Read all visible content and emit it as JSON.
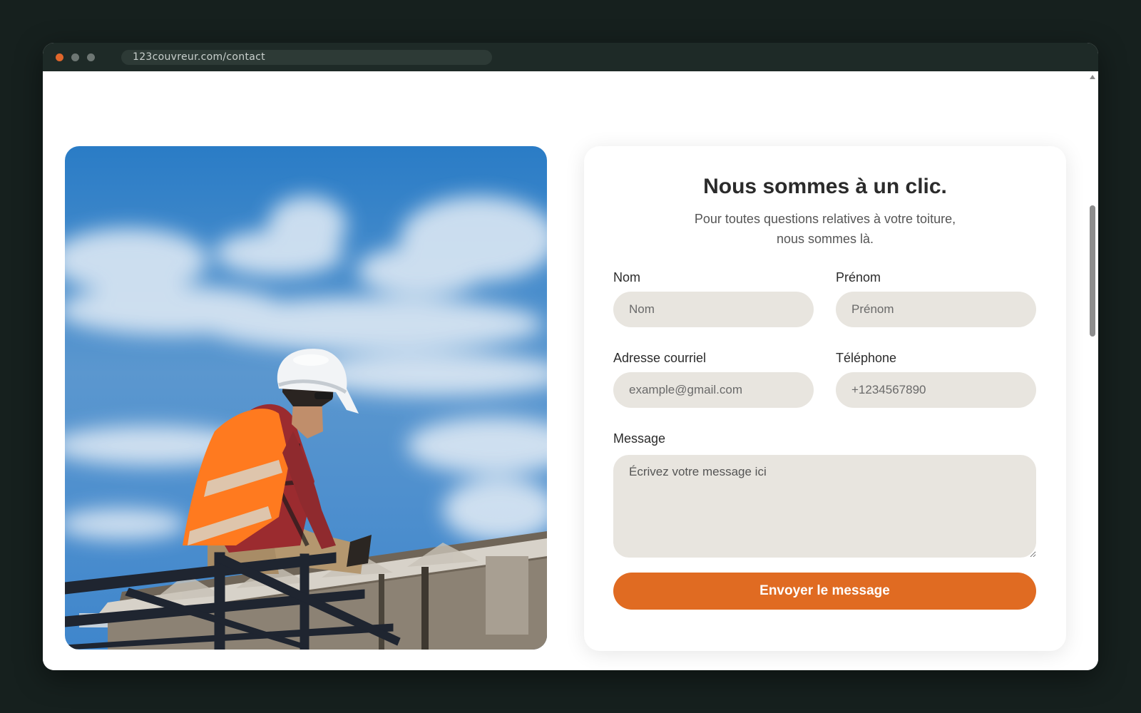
{
  "browser": {
    "url": "123couvreur.com/contact"
  },
  "hero_image": {
    "subject": "roofer-with-hard-hat",
    "colors": {
      "sky": "#2e7dc4",
      "vest": "#ff7a1f",
      "helmet": "#f2f4f6"
    }
  },
  "contact": {
    "title": "Nous sommes à un clic.",
    "subtitle_line1": "Pour toutes questions relatives à votre toiture,",
    "subtitle_line2": "nous sommes là.",
    "fields": {
      "nom": {
        "label": "Nom",
        "placeholder": "Nom"
      },
      "prenom": {
        "label": "Prénom",
        "placeholder": "Prénom"
      },
      "email": {
        "label": "Adresse courriel",
        "placeholder": "example@gmail.com"
      },
      "telephone": {
        "label": "Téléphone",
        "placeholder": "+1234567890"
      },
      "message": {
        "label": "Message",
        "placeholder": "Écrivez votre message ici"
      }
    },
    "submit_label": "Envoyer le message"
  },
  "theme": {
    "accent": "#e06b22",
    "field_bg": "#e8e5df",
    "chrome_bg": "#1e2a27",
    "page_bg": "#16201e"
  }
}
